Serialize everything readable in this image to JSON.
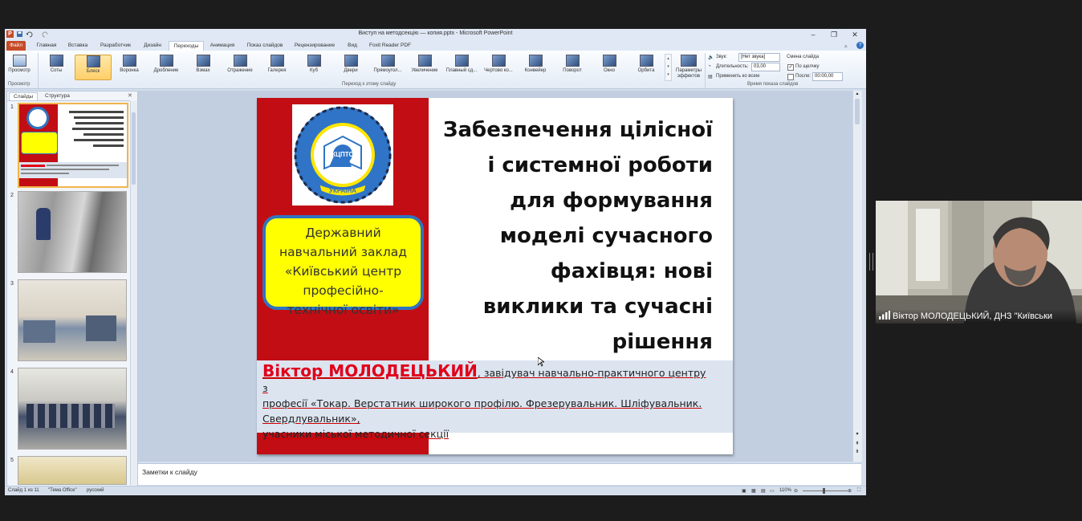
{
  "window": {
    "title": "Виступ на методсекцію — копия.pptx - Microsoft PowerPoint"
  },
  "tabs": [
    "Файл",
    "Главная",
    "Вставка",
    "Разработчик",
    "Дизайн",
    "Переходы",
    "Анимация",
    "Показ слайдов",
    "Рецензирование",
    "Вид",
    "Foxit Reader PDF"
  ],
  "ribbon": {
    "preview_label": "Просмотр",
    "transitions": [
      "Соты",
      "Блеск",
      "Воронка",
      "Дробление",
      "Взмах",
      "Отражение",
      "Галерея",
      "Куб",
      "Двери",
      "Прямоугол...",
      "Увеличение",
      "Плавный сд...",
      "Чертово ко...",
      "Конвейер",
      "Поворот",
      "Окно",
      "Орбита"
    ],
    "effect_params_label": "Параметры эффектов",
    "sound_label": "Звук:",
    "sound_value": "[Нет звука]",
    "duration_label": "Длительность:",
    "duration_value": "03,00",
    "apply_all_label": "Применить ко всем",
    "change_slide_label": "Смена слайда",
    "on_click_label": "По щелчку",
    "after_label": "После:",
    "after_value": "00:00,00",
    "group_preview": "Просмотр",
    "group_transition": "Переход к этому слайду",
    "group_timing": "Время показа слайдов"
  },
  "left_panel": {
    "tab_slides": "Слайды",
    "tab_outline": "Структура",
    "thumbs": [
      "1",
      "2",
      "3",
      "4",
      "5"
    ]
  },
  "slide": {
    "yellow_lines": [
      "Державний",
      "навчальний заклад",
      "«Київський центр",
      "професійно-",
      "технічної освіти»"
    ],
    "title_lines": [
      "Забезпечення цілісної",
      "і системної роботи",
      "для формування",
      "моделі сучасного",
      "фахівця: нові",
      "виклики та сучасні",
      "рішення"
    ],
    "author_name": "Віктор МОЛОДЕЦЬКИЙ",
    "author_rest_1": ", завідувач навчально-практичного центру з",
    "author_line_2": "професії «Токар. Верстатник широкого профілю. Фрезерувальник. Шліфувальник.",
    "author_line_3": "Свердлувальник»,",
    "author_line_4": "учасники міської методичної секції",
    "logo_text_top": "КЦПТО",
    "logo_ribbon": "УКРАЇНА"
  },
  "notes": {
    "placeholder": "Заметки к слайду"
  },
  "status": {
    "slide_info": "Слайд 1 из 11",
    "theme": "\"Тема Office\"",
    "language": "русский",
    "zoom": "110%"
  },
  "video": {
    "caption": "Віктор МОЛОДЕЦЬКИЙ, ДНЗ \"Київськи"
  },
  "colors": {
    "slide_red": "#c30d14",
    "yellow_box": "#ffff00",
    "box_border": "#2e74c0",
    "author_red": "#e0001a"
  }
}
